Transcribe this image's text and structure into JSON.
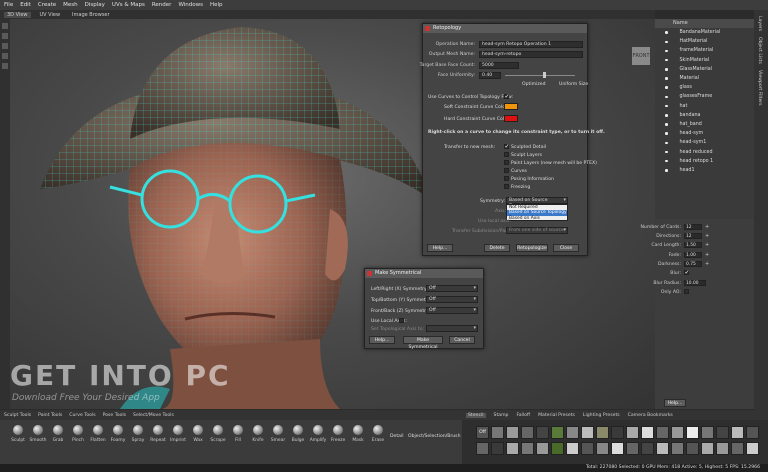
{
  "menu": [
    "File",
    "Edit",
    "Create",
    "Mesh",
    "Display",
    "UVs & Maps",
    "Render",
    "Windows",
    "Help"
  ],
  "view_tabs": [
    "3D View",
    "UV View",
    "Image Browser"
  ],
  "viewcube": "FRONT",
  "watermark": {
    "line1": "GET INTO PC",
    "line2": "Download Free Your Desired App"
  },
  "retopo": {
    "title": "Retopology",
    "operation_name_label": "Operation Name:",
    "operation_name": "head-sym Retopo Operation 1",
    "output_mesh_label": "Output Mesh Name:",
    "output_mesh": "head-sym-retopo",
    "target_face_label": "Target Base Face Count:",
    "target_face": "5000",
    "face_uniformity_label": "Face Uniformity:",
    "face_uniformity": "0.40",
    "optimized": "Optimized",
    "uniform_size": "Uniform Size",
    "use_curves_label": "Use Curves to Control Topology Flow:",
    "soft_curve_label": "Soft Constraint Curve Color:",
    "hard_curve_label": "Hard Constraint Curve Color:",
    "soft_color": "#f0940a",
    "hard_color": "#e01010",
    "hint": "Right-click on a curve to change its constraint type, or to turn it off.",
    "transfer_label": "Transfer to new mesh:",
    "transfer_options": [
      "Sculpted Detail",
      "Sculpt Layers",
      "Paint Layers (new mesh will be PTEX)",
      "Curves",
      "Posing Information",
      "Freezing"
    ],
    "symmetry_label": "Symmetry:",
    "symmetry_value": "Based on Source Topology",
    "symmetry_options": [
      "Not Required",
      "Based on Source Topology",
      "Based on Axis"
    ],
    "axis_label": "Axis:",
    "use_axis_label": "Use local axis:",
    "transfer_sub_label": "Transfer Subdivision/Painting:",
    "transfer_sub_value": "From one side of source",
    "buttons": [
      "Help...",
      "Delete",
      "Retopologize",
      "Close"
    ]
  },
  "symmetrical": {
    "title": "Make Symmetrical",
    "rows": [
      {
        "label": "Left/Right (X) Symmetry:",
        "value": "Off"
      },
      {
        "label": "Top/Bottom (Y) Symmetry:",
        "value": "Off"
      },
      {
        "label": "Front/Back (Z) Symmetry:",
        "value": "Off"
      }
    ],
    "use_local_axes": "Use Local Axes:",
    "set_topo_axis": "Set Topological Axis to:",
    "buttons": [
      "Help...",
      "Make Symmetrical",
      "Cancel"
    ]
  },
  "outliner": {
    "header": "Name",
    "items": [
      "BandanaMaterial",
      "HatMaterial",
      "frameMaterial",
      "SkinMaterial",
      "GlassMaterial",
      "Material",
      "glass",
      "glassesFrame",
      "hat",
      "bandana",
      "hat_band",
      "head-sym",
      "head-sym1",
      "head reduced",
      "head retopo 1",
      "head1"
    ]
  },
  "right_tabs": [
    "Layers",
    "Object Lists",
    "Viewport Filters"
  ],
  "props": [
    {
      "label": "Number of Cards:",
      "value": "12"
    },
    {
      "label": "Directions:",
      "value": "12"
    },
    {
      "label": "Card Length:",
      "value": "1.50"
    },
    {
      "label": "Fade:",
      "value": "1.00"
    },
    {
      "label": "Darkness:",
      "value": "0.75"
    },
    {
      "label": "Blur:",
      "value": ""
    },
    {
      "label": "Blur Radius:",
      "value": "10.00"
    },
    {
      "label": "Only AO:",
      "value": ""
    }
  ],
  "props_help": "Help...",
  "tool_tabs": [
    "Sculpt Tools",
    "Paint Tools",
    "Curve Tools",
    "Pose Tools",
    "Select/Move Tools"
  ],
  "tools": [
    "Sculpt",
    "Smooth",
    "Grab",
    "Pinch",
    "Flatten",
    "Foamy",
    "Spray",
    "Repeat",
    "Imprint",
    "Wax",
    "Scrape",
    "Fill",
    "Knife",
    "Smear",
    "Bulge",
    "Amplify",
    "Freeze",
    "Mask",
    "Erase"
  ],
  "tool_extra": [
    "Detail",
    "Object/Selection/Brush"
  ],
  "mat_tabs": [
    "Stamp",
    "Falloff",
    "Material Presets",
    "Lighting Presets",
    "Camera Bookmarks"
  ],
  "mat_first_tab": "Stencil",
  "mat_first_tile": "Off",
  "status": "Total: 227080  Selected: 0  GPU Mem: 418  Active: 5, Highest: 5  FPS: 15.2966"
}
